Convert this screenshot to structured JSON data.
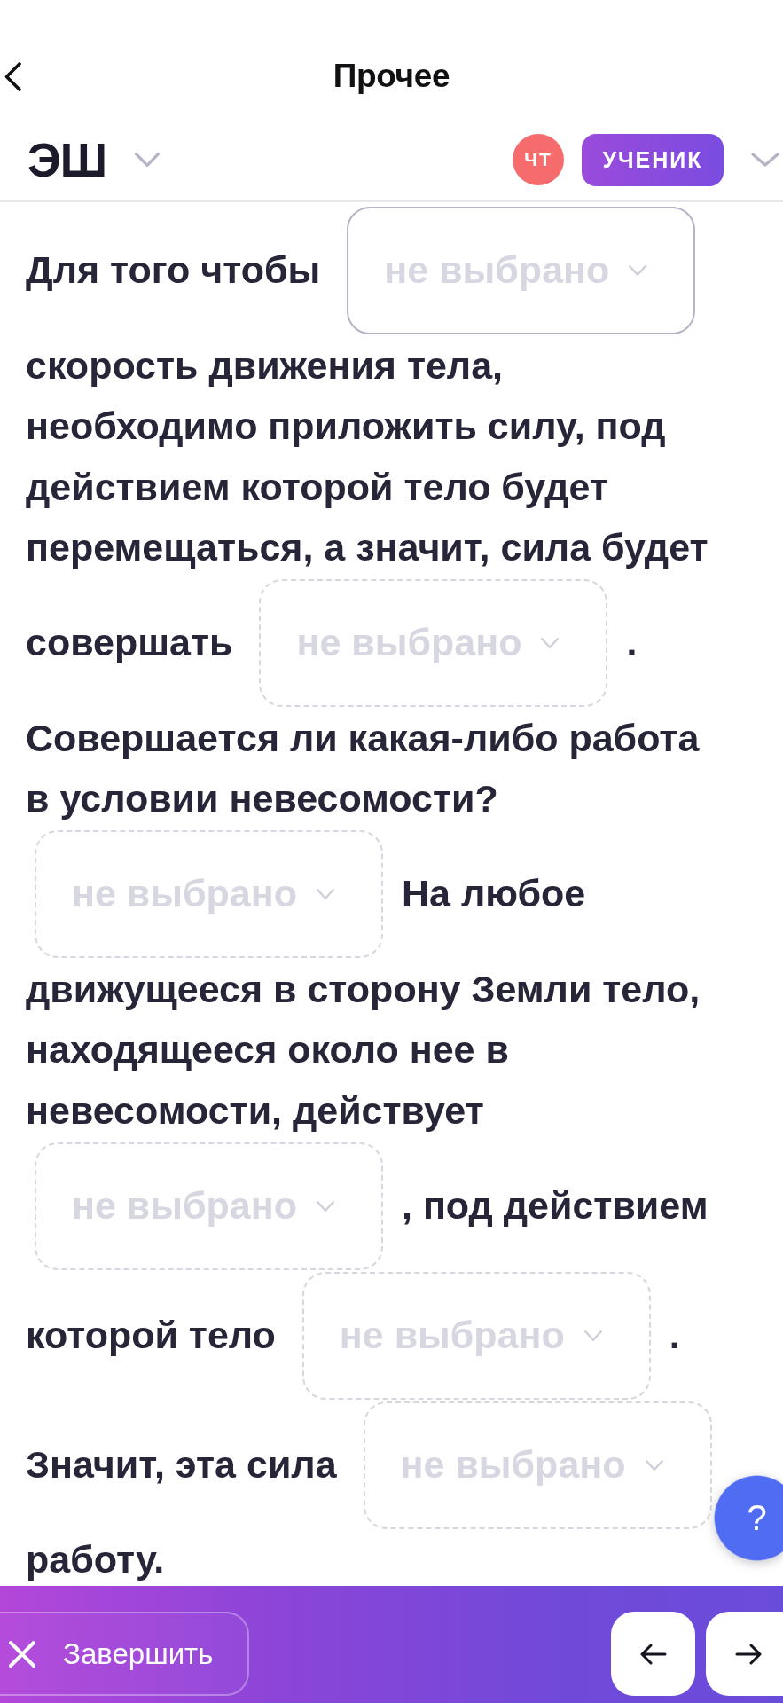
{
  "nav": {
    "title": "Прочее"
  },
  "header": {
    "logo": "ЭШ",
    "avatar": "ЧТ",
    "role": "УЧЕНИК"
  },
  "exercise": {
    "lines": [
      [
        {
          "kind": "text",
          "text": "Для того чтобы"
        },
        {
          "kind": "dropdown",
          "placeholder": "не выбрано",
          "focused": true
        }
      ],
      [
        {
          "kind": "text",
          "text": "скорость движения тела,"
        }
      ],
      [
        {
          "kind": "text",
          "text": "необходимо приложить силу, под"
        }
      ],
      [
        {
          "kind": "text",
          "text": "действием которой тело будет"
        }
      ],
      [
        {
          "kind": "text",
          "text": "перемещаться, а значит, сила будет"
        }
      ],
      [
        {
          "kind": "text",
          "text": "совершать"
        },
        {
          "kind": "dropdown",
          "placeholder": "не выбрано",
          "focused": false
        },
        {
          "kind": "text",
          "text": "."
        }
      ],
      [
        {
          "kind": "text",
          "text": "Совершается ли какая-либо работа"
        }
      ],
      [
        {
          "kind": "text",
          "text": "в условии невесомости?"
        }
      ],
      [
        {
          "kind": "dropdown",
          "placeholder": "не выбрано",
          "focused": false
        },
        {
          "kind": "text",
          "text": "На любое"
        }
      ],
      [
        {
          "kind": "text",
          "text": "движущееся в сторону Земли тело,"
        }
      ],
      [
        {
          "kind": "text",
          "text": "находящееся около нее в"
        }
      ],
      [
        {
          "kind": "text",
          "text": "невесомости, действует"
        }
      ],
      [
        {
          "kind": "dropdown",
          "placeholder": "не выбрано",
          "focused": false
        },
        {
          "kind": "text",
          "text": ", под действием"
        }
      ],
      [
        {
          "kind": "text",
          "text": "которой тело"
        },
        {
          "kind": "dropdown",
          "placeholder": "не выбрано",
          "focused": false
        },
        {
          "kind": "text",
          "text": "."
        }
      ],
      [
        {
          "kind": "text",
          "text": "Значит, эта сила"
        },
        {
          "kind": "dropdown",
          "placeholder": "не выбрано",
          "focused": false
        }
      ],
      [
        {
          "kind": "text",
          "text": "работу."
        }
      ]
    ]
  },
  "help_button": {
    "label": "?"
  },
  "footer": {
    "finish_button": "Завершить"
  }
}
